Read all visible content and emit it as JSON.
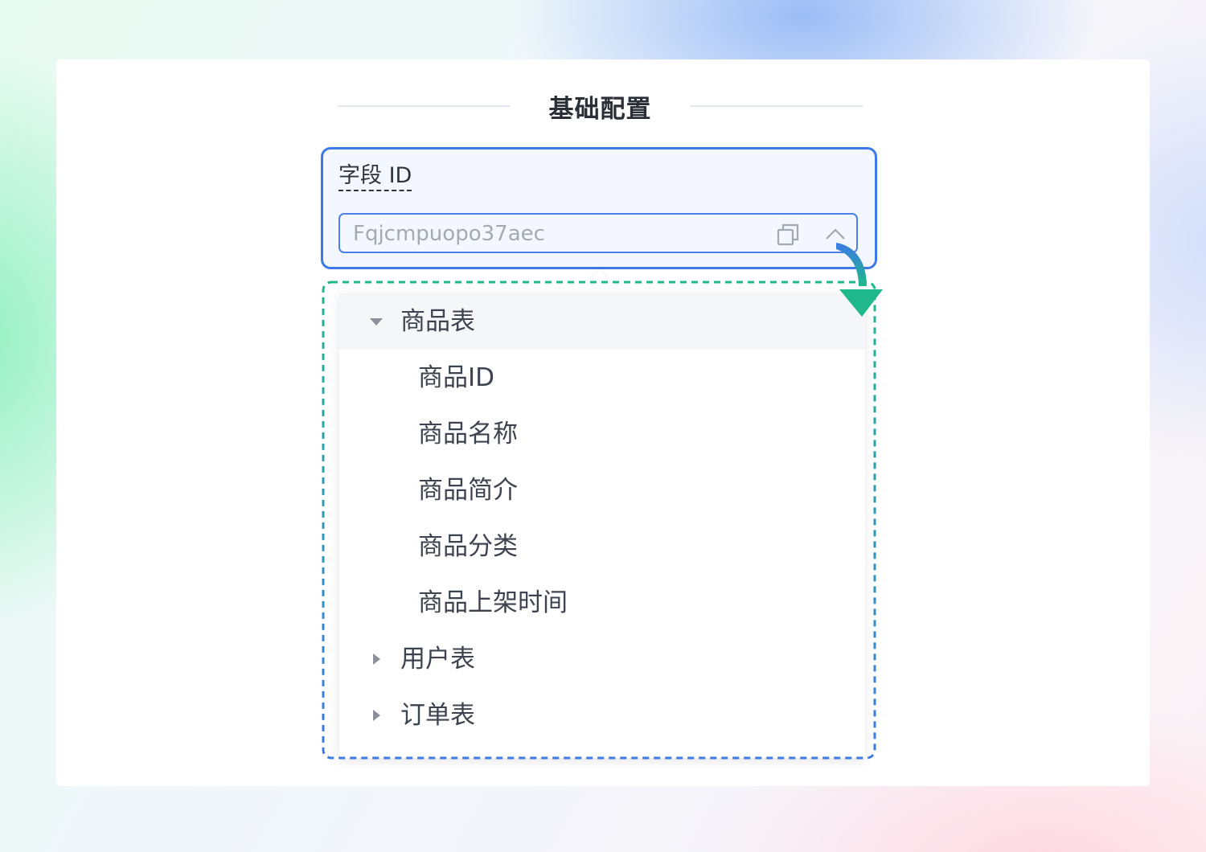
{
  "section": {
    "title": "基础配置"
  },
  "field": {
    "label": "字段 ID",
    "value": "Fqjcmpuopo37aec",
    "copy_icon": "copy-icon",
    "toggle_icon": "chevron-up-icon"
  },
  "tree": {
    "groups": [
      {
        "label": "商品表",
        "expanded": true,
        "children": [
          "商品ID",
          "商品名称",
          "商品简介",
          "商品分类",
          "商品上架时间"
        ]
      },
      {
        "label": "用户表",
        "expanded": false
      },
      {
        "label": "订单表",
        "expanded": false
      }
    ]
  },
  "colors": {
    "accent": "#3b7ae8",
    "annotation_green": "#1fb88a",
    "text": "#3d4350"
  }
}
